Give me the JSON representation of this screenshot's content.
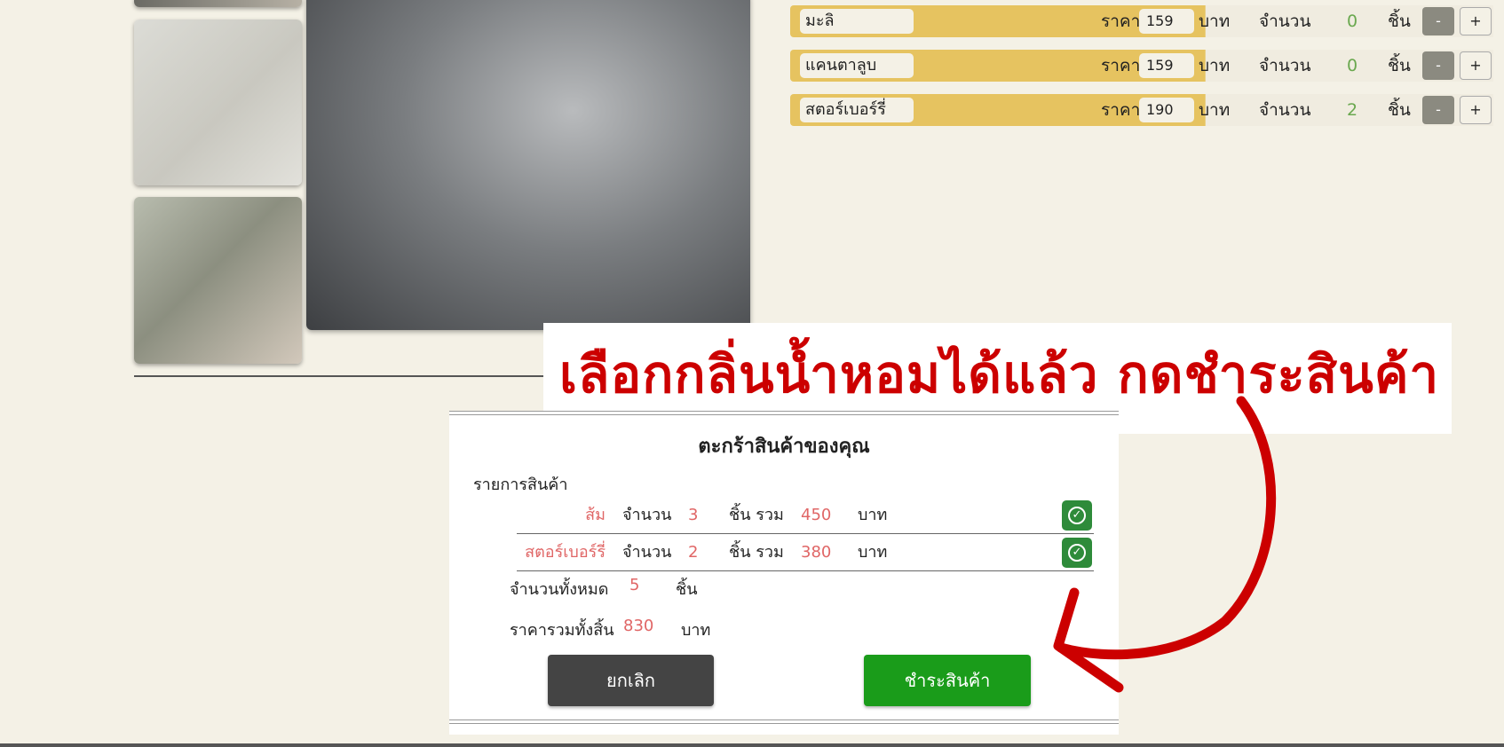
{
  "products": [
    {
      "name": "มะลิ",
      "price_label": "ราคา",
      "price": "159",
      "unit": "บาท",
      "qty_label": "จำนวน",
      "qty": "0",
      "piece": "ชิ้น",
      "minus": "-",
      "plus": "+"
    },
    {
      "name": "แคนตาลูบ",
      "price_label": "ราคา",
      "price": "159",
      "unit": "บาท",
      "qty_label": "จำนวน",
      "qty": "0",
      "piece": "ชิ้น",
      "minus": "-",
      "plus": "+"
    },
    {
      "name": "สตอร์เบอร์รี่",
      "price_label": "ราคา",
      "price": "190",
      "unit": "บาท",
      "qty_label": "จำนวน",
      "qty": "2",
      "piece": "ชิ้น",
      "minus": "-",
      "plus": "+"
    }
  ],
  "annotation": {
    "text": "เลือกกลิ่นน้ำหอมได้แล้ว กดชำระสินค้า",
    "color": "#cc0000"
  },
  "cart": {
    "title": "ตะกร้าสินค้าของคุณ",
    "items_label": "รายการสินค้า",
    "items": [
      {
        "name": "ส้ม",
        "qty_label": "จำนวน",
        "qty": "3",
        "piece_total": "ชิ้น รวม",
        "sum": "450",
        "baht": "บาท",
        "icon": "check-circle-icon"
      },
      {
        "name": "สตอร์เบอร์รี่",
        "qty_label": "จำนวน",
        "qty": "2",
        "piece_total": "ชิ้น รวม",
        "sum": "380",
        "baht": "บาท",
        "icon": "check-circle-icon"
      }
    ],
    "total_qty_label": "จำนวนทั้งหมด",
    "total_qty": "5",
    "total_qty_unit": "ชิ้น",
    "total_price_label": "ราคารวมทั้งสิ้น",
    "total_price": "830",
    "total_price_unit": "บาท",
    "cancel_label": "ยกเลิก",
    "pay_label": "ชำระสินค้า"
  },
  "colors": {
    "background": "#f4f1e6",
    "row_accent": "#e6c360",
    "value_red": "#e06666",
    "qty_green": "#6aa84f",
    "pay_green": "#1a9c1a",
    "cancel_dark": "#444444"
  }
}
